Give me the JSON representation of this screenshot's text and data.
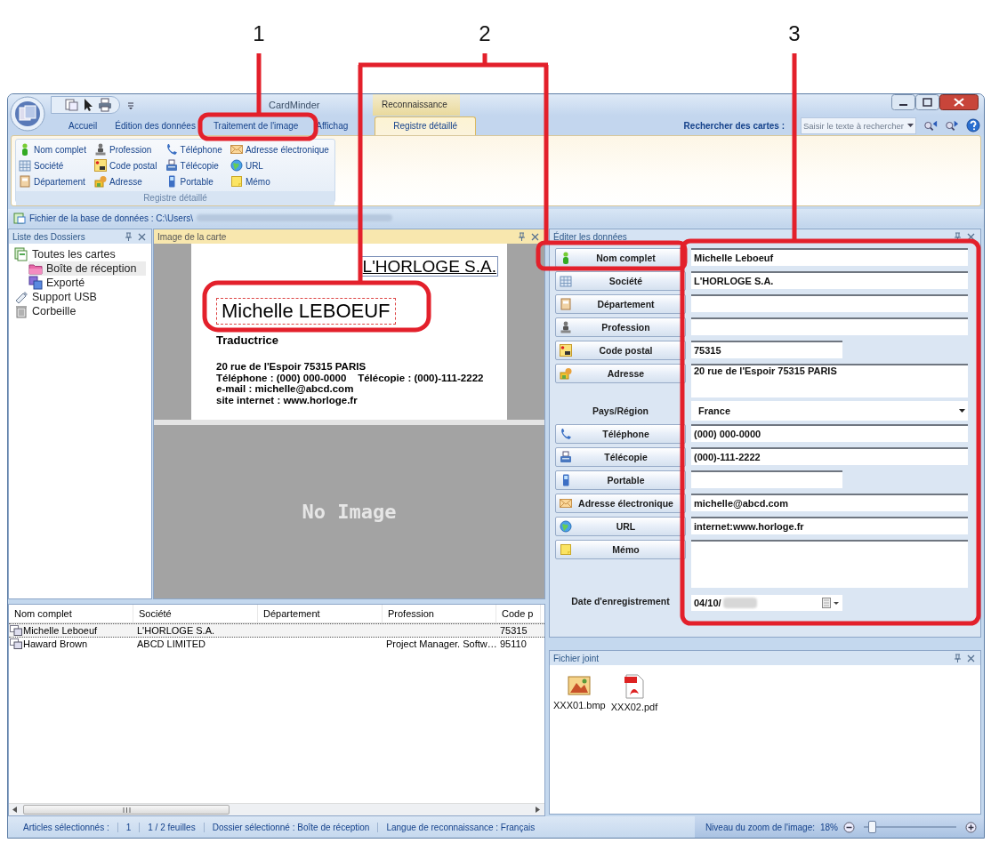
{
  "callouts": [
    {
      "label": "1"
    },
    {
      "label": "2"
    },
    {
      "label": "3"
    }
  ],
  "window": {
    "title": "CardMinder",
    "context_tab": "Reconnaissance"
  },
  "tabs": [
    {
      "label": "Accueil",
      "selected": false
    },
    {
      "label": "Édition des données",
      "selected": false
    },
    {
      "label": "Traitement de l'image",
      "selected": false
    },
    {
      "label": "Affichag",
      "selected": false
    },
    {
      "label": "Registre détaillé",
      "selected": true
    }
  ],
  "search": {
    "label": "Rechercher des cartes :",
    "placeholder": "Saisir le texte à rechercher"
  },
  "ribbon": {
    "group_label": "Registre détaillé",
    "items": [
      {
        "label": "Nom complet"
      },
      {
        "label": "Société"
      },
      {
        "label": "Département"
      },
      {
        "label": "Profession"
      },
      {
        "label": "Code postal"
      },
      {
        "label": "Adresse"
      },
      {
        "label": "Téléphone"
      },
      {
        "label": "Télécopie"
      },
      {
        "label": "Portable"
      },
      {
        "label": "Adresse électronique"
      },
      {
        "label": "URL"
      },
      {
        "label": "Mémo"
      }
    ]
  },
  "path_bar": {
    "label": "Fichier de la base de données : C:\\Users\\"
  },
  "folders": {
    "title": "Liste des Dossiers",
    "items": [
      {
        "label": "Toutes les cartes",
        "selected": false,
        "children": [
          {
            "label": "Boîte de réception",
            "selected": true
          },
          {
            "label": "Exporté",
            "selected": false
          }
        ]
      },
      {
        "label": "Support USB",
        "selected": false
      },
      {
        "label": "Corbeille",
        "selected": false
      }
    ]
  },
  "card_image": {
    "title": "Image de la carte",
    "company": "L'HORLOGE S.A.",
    "name": "Michelle LEBOEUF",
    "job": "Traductrice",
    "lines": [
      "20 rue de l'Espoir 75315 PARIS",
      "Téléphone : (000) 000-0000    Télécopie : (000)-111-2222",
      "e-mail : michelle@abcd.com",
      "site internet : www.horloge.fr"
    ],
    "empty_text": "No Image"
  },
  "edit": {
    "title": "Éditer les données",
    "fields": [
      {
        "kind": "text",
        "label": "Nom complet",
        "value": "Michelle Leboeuf"
      },
      {
        "kind": "text",
        "label": "Société",
        "value": "L'HORLOGE S.A."
      },
      {
        "kind": "text",
        "label": "Département"
      },
      {
        "kind": "text",
        "label": "Profession"
      },
      {
        "kind": "short",
        "label": "Code postal",
        "value": "75315"
      },
      {
        "kind": "multi",
        "label": "Adresse",
        "value": "20 rue de l'Espoir 75315 PARIS"
      },
      {
        "kind": "select",
        "label": "Pays/Région",
        "value": "France"
      },
      {
        "kind": "text",
        "label": "Téléphone",
        "value": "(000) 000-0000"
      },
      {
        "kind": "text",
        "label": "Télécopie",
        "value": "(000)-111-2222"
      },
      {
        "kind": "short",
        "label": "Portable"
      },
      {
        "kind": "text",
        "label": "Adresse électronique",
        "value": "michelle@abcd.com"
      },
      {
        "kind": "text",
        "label": "URL",
        "value": "internet:www.horloge.fr"
      },
      {
        "kind": "memo",
        "label": "Mémo"
      },
      {
        "kind": "date",
        "label": "Date d'enregistrement",
        "value": "04/10/"
      }
    ]
  },
  "list": {
    "columns": [
      "Nom complet",
      "Société",
      "Département",
      "Profession",
      "Code p"
    ],
    "rows": [
      {
        "name": "Michelle Leboeuf",
        "company": "L'HORLOGE S.A.",
        "code": "75315",
        "selected": true
      },
      {
        "name": "Haward Brown",
        "company": "ABCD LIMITED",
        "profession": "Project Manager. Softw…",
        "code": "95110",
        "selected": false
      }
    ]
  },
  "attachments": {
    "title": "Fichier joint",
    "files": [
      {
        "name": "XXX01.bmp",
        "kind": "image"
      },
      {
        "name": "XXX02.pdf",
        "kind": "pdf"
      }
    ]
  },
  "status_bar": {
    "items": [
      "Articles sélectionnés :",
      "1",
      "1 / 2  feuilles",
      "Dossier sélectionné : Boîte de réception",
      "Langue de reconnaissance : Français"
    ],
    "zoom_label": "Niveau du zoom de l'image:",
    "zoom_value": "18%",
    "zoom": {
      "level": 0.05
    }
  }
}
